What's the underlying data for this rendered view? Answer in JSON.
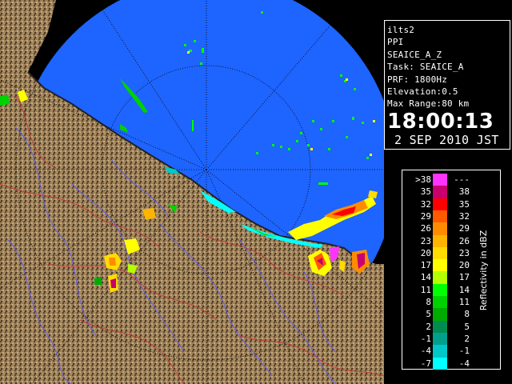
{
  "radar": {
    "station": "ilts2",
    "mode": "PPI",
    "product": "SEAICE_A_Z",
    "task": "Task: SEAICE_A",
    "prf": "PRF: 1800Hz",
    "elevation": "Elevation:0.5",
    "max_range": "Max Range:80 km",
    "time": "18:00:13",
    "date": "2 SEP 2010 JST"
  },
  "legend": {
    "title": "Reflectivity in dBZ",
    "rows": [
      {
        "lo": ">38",
        "hi": "---",
        "color": "#ff33ff"
      },
      {
        "lo": "35",
        "hi": "38",
        "color": "#c8006e"
      },
      {
        "lo": "32",
        "hi": "35",
        "color": "#ff0000"
      },
      {
        "lo": "29",
        "hi": "32",
        "color": "#ff5a00"
      },
      {
        "lo": "26",
        "hi": "29",
        "color": "#ff8c00"
      },
      {
        "lo": "23",
        "hi": "26",
        "color": "#ffb400"
      },
      {
        "lo": "20",
        "hi": "23",
        "color": "#ffdc00"
      },
      {
        "lo": "17",
        "hi": "20",
        "color": "#ffff00"
      },
      {
        "lo": "14",
        "hi": "17",
        "color": "#b4ff00"
      },
      {
        "lo": "11",
        "hi": "14",
        "color": "#00ff00"
      },
      {
        "lo": "8",
        "hi": "11",
        "color": "#00d200"
      },
      {
        "lo": "5",
        "hi": "8",
        "color": "#00aa00"
      },
      {
        "lo": "2",
        "hi": "5",
        "color": "#008c50"
      },
      {
        "lo": "-1",
        "hi": "2",
        "color": "#00a08c"
      },
      {
        "lo": "-4",
        "hi": "-1",
        "color": "#00c8c8"
      },
      {
        "lo": "-7",
        "hi": "-4",
        "color": "#00ffff"
      }
    ]
  },
  "colors": {
    "sea": "#1e64ff",
    "land": "#8c7350",
    "rivers": "#5050ff",
    "borders": "#c83232"
  }
}
